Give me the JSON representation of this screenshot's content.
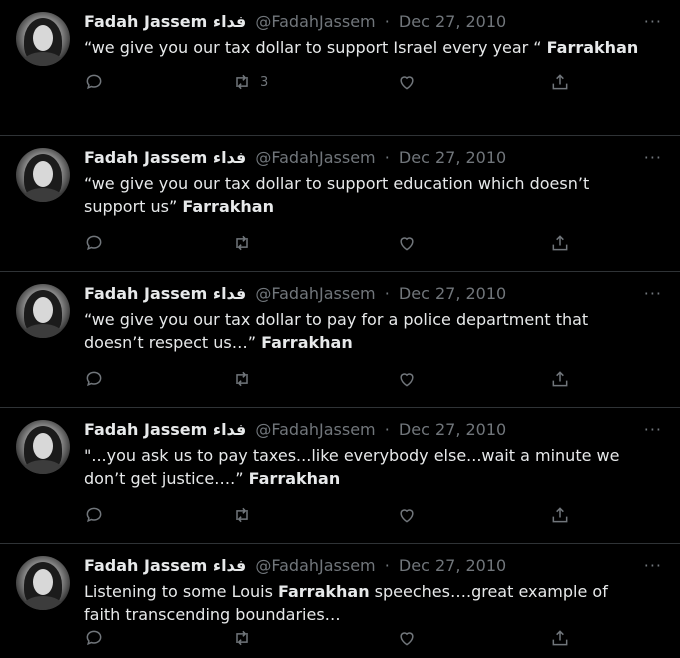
{
  "tweets": [
    {
      "name": "Fadah Jassem فداء",
      "handle": "@FadahJassem",
      "sep": "·",
      "date": "Dec 27, 2010",
      "more": "···",
      "text_before": "“we give you our tax dollar to support Israel every year “ ",
      "text_bold": "Farrakhan",
      "text_after": "",
      "retweets": "3"
    },
    {
      "name": "Fadah Jassem فداء",
      "handle": "@FadahJassem",
      "sep": "·",
      "date": "Dec 27, 2010",
      "more": "···",
      "text_before": "“we give you our tax dollar to support education which doesn’t support us” ",
      "text_bold": "Farrakhan",
      "text_after": "",
      "retweets": ""
    },
    {
      "name": "Fadah Jassem فداء",
      "handle": "@FadahJassem",
      "sep": "·",
      "date": "Dec 27, 2010",
      "more": "···",
      "text_before": "“we give you our tax dollar to pay for a police department that doesn’t respect us…” ",
      "text_bold": "Farrakhan",
      "text_after": "",
      "retweets": ""
    },
    {
      "name": "Fadah Jassem فداء",
      "handle": "@FadahJassem",
      "sep": "·",
      "date": "Dec 27, 2010",
      "more": "···",
      "text_before": "\"...you ask us to pay taxes...like everybody else...wait a minute we don’t get justice….” ",
      "text_bold": "Farrakhan",
      "text_after": "",
      "retweets": ""
    },
    {
      "name": "Fadah Jassem فداء",
      "handle": "@FadahJassem",
      "sep": "·",
      "date": "Dec 27, 2010",
      "more": "···",
      "text_before": "Listening to some Louis ",
      "text_bold": "Farrakhan",
      "text_after": " speeches….great example of faith transcending boundaries…",
      "retweets": ""
    }
  ],
  "icons": {
    "reply": "reply-icon",
    "retweet": "retweet-icon",
    "like": "like-icon",
    "share": "share-icon",
    "more": "more-icon"
  },
  "colors": {
    "background": "#000000",
    "text": "#e7e9ea",
    "muted": "#71767b",
    "divider": "#2f3336"
  }
}
